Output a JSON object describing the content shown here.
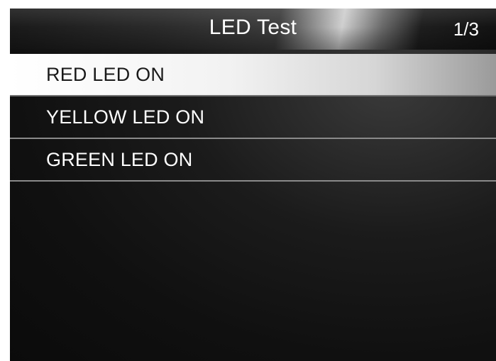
{
  "header": {
    "title": "LED Test",
    "page_indicator": "1/3"
  },
  "menu": {
    "selected_index": 0,
    "items": [
      {
        "label": "RED LED ON"
      },
      {
        "label": "YELLOW LED ON"
      },
      {
        "label": "GREEN LED ON"
      }
    ]
  },
  "colors": {
    "background": "#101010",
    "selected_row": "#f2f2f2",
    "text": "#ffffff",
    "selected_text": "#1a1a1a",
    "divider": "#8a8a8a"
  }
}
